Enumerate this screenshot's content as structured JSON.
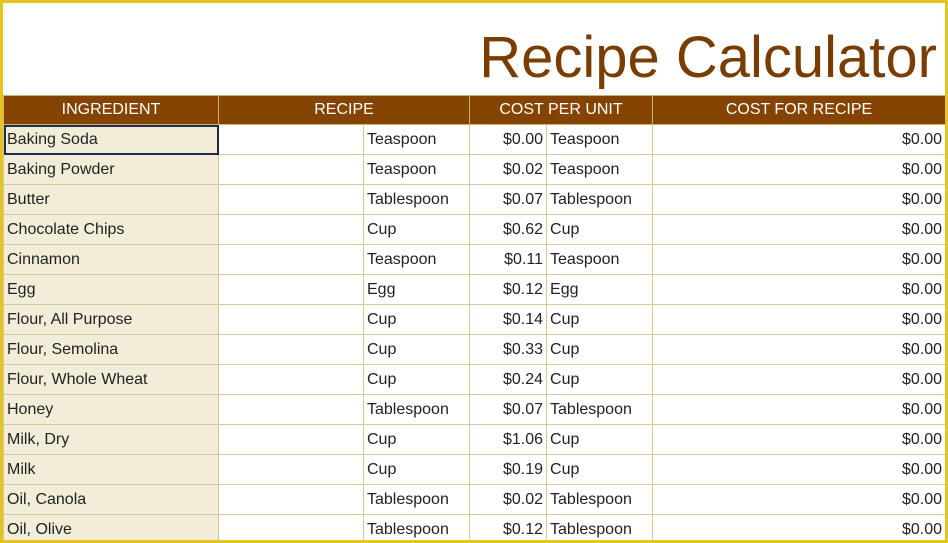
{
  "title": "Recipe Calculator",
  "headers": [
    "INGREDIENT",
    "RECIPE",
    "COST PER UNIT",
    "COST FOR RECIPE"
  ],
  "rows": [
    {
      "ingredient": "Baking Soda",
      "recipe_unit": "Teaspoon",
      "cost": "$0.00",
      "cost_unit": "Teaspoon",
      "total": "$0.00"
    },
    {
      "ingredient": "Baking Powder",
      "recipe_unit": "Teaspoon",
      "cost": "$0.02",
      "cost_unit": "Teaspoon",
      "total": "$0.00"
    },
    {
      "ingredient": "Butter",
      "recipe_unit": "Tablespoon",
      "cost": "$0.07",
      "cost_unit": "Tablespoon",
      "total": "$0.00"
    },
    {
      "ingredient": "Chocolate Chips",
      "recipe_unit": "Cup",
      "cost": "$0.62",
      "cost_unit": "Cup",
      "total": "$0.00"
    },
    {
      "ingredient": "Cinnamon",
      "recipe_unit": "Teaspoon",
      "cost": "$0.11",
      "cost_unit": "Teaspoon",
      "total": "$0.00"
    },
    {
      "ingredient": "Egg",
      "recipe_unit": "Egg",
      "cost": "$0.12",
      "cost_unit": "Egg",
      "total": "$0.00"
    },
    {
      "ingredient": "Flour, All Purpose",
      "recipe_unit": "Cup",
      "cost": "$0.14",
      "cost_unit": "Cup",
      "total": "$0.00"
    },
    {
      "ingredient": "Flour, Semolina",
      "recipe_unit": "Cup",
      "cost": "$0.33",
      "cost_unit": "Cup",
      "total": "$0.00"
    },
    {
      "ingredient": "Flour, Whole Wheat",
      "recipe_unit": "Cup",
      "cost": "$0.24",
      "cost_unit": "Cup",
      "total": "$0.00"
    },
    {
      "ingredient": "Honey",
      "recipe_unit": "Tablespoon",
      "cost": "$0.07",
      "cost_unit": "Tablespoon",
      "total": "$0.00"
    },
    {
      "ingredient": "Milk, Dry",
      "recipe_unit": "Cup",
      "cost": "$1.06",
      "cost_unit": "Cup",
      "total": "$0.00"
    },
    {
      "ingredient": "Milk",
      "recipe_unit": "Cup",
      "cost": "$0.19",
      "cost_unit": "Cup",
      "total": "$0.00"
    },
    {
      "ingredient": "Oil, Canola",
      "recipe_unit": "Tablespoon",
      "cost": "$0.02",
      "cost_unit": "Tablespoon",
      "total": "$0.00"
    },
    {
      "ingredient": "Oil, Olive",
      "recipe_unit": "Tablespoon",
      "cost": "$0.12",
      "cost_unit": "Tablespoon",
      "total": "$0.00"
    }
  ]
}
